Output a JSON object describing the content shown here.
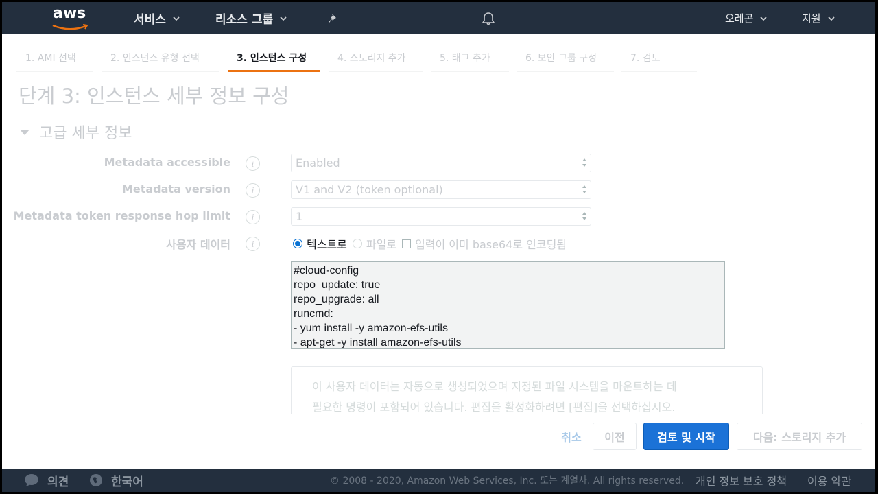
{
  "topnav": {
    "logo": "aws",
    "services": "서비스",
    "resource_groups": "리소스 그룹",
    "region": "오레곤",
    "support": "지원",
    "icons": [
      "pin-icon",
      "bell-icon"
    ]
  },
  "tabs": [
    {
      "label": "1. AMI 선택"
    },
    {
      "label": "2. 인스턴스 유형 선택"
    },
    {
      "label": "3. 인스턴스 구성"
    },
    {
      "label": "4. 스토리지 추가"
    },
    {
      "label": "5. 태그 추가"
    },
    {
      "label": "6. 보안 그룹 구성"
    },
    {
      "label": "7. 검토"
    }
  ],
  "active_tab": "3. 인스턴스 구성",
  "page_title": "단계 3: 인스턴스 세부 정보 구성",
  "section_title": "고급 세부 정보",
  "fields": {
    "metadata_accessible": {
      "label": "Metadata accessible",
      "value": "Enabled"
    },
    "metadata_version": {
      "label": "Metadata version",
      "value": "V1 and V2 (token optional)"
    },
    "hop_limit": {
      "label": "Metadata token response hop limit",
      "value": "1"
    },
    "user_data": {
      "label": "사용자 데이터",
      "option_text": "텍스트로",
      "option_file": "파일로",
      "option_base64": "입력이 이미 base64로 인코딩됨",
      "selected": "텍스트로",
      "lines": [
        "#cloud-config",
        "repo_update: true",
        "repo_upgrade: all",
        "runcmd:",
        "- yum install -y amazon-efs-utils",
        "- apt-get -y install amazon-efs-utils"
      ]
    }
  },
  "info_box": {
    "line1": "이 사용자 데이터는 자동으로 생성되었으며 지정된 파일 시스템을 마운트하는 데",
    "line2": "필요한 명령이 포함되어 있습니다. 편집을 활성화하려면 [편집]을 선택하십시오."
  },
  "actions": {
    "cancel": "취소",
    "previous": "이전",
    "review_launch": "검토 및 시작",
    "next": "다음: 스토리지 추가"
  },
  "footer": {
    "feedback": "의견",
    "language": "한국어",
    "copyright": "© 2008 - 2020, Amazon Web Services, Inc. 또는 계열사. All rights reserved.",
    "privacy": "개인 정보 보호 정책",
    "terms": "이용 약관"
  },
  "colors": {
    "nav_bg": "#232f3e",
    "accent_orange": "#ec7211",
    "primary_blue": "#1b72d7"
  }
}
